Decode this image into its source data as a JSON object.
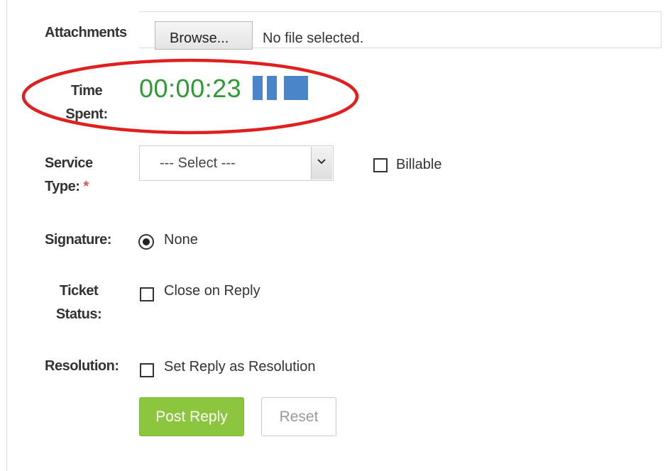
{
  "form": {
    "attachments": {
      "label": "Attachments",
      "browse_label": "Browse...",
      "status": "No file selected."
    },
    "time_spent": {
      "label_line1": "Time",
      "label_line2": "Spent:",
      "value": "00:00:23",
      "pause_icon": "pause-icon",
      "stop_icon": "stop-icon",
      "timer_color": "#2f9a35",
      "control_color": "#4a85c9"
    },
    "service_type": {
      "label_line1": "Service",
      "label_line2": "Type:",
      "required_mark": "*",
      "selected": "--- Select ---"
    },
    "billable": {
      "label": "Billable",
      "checked": false
    },
    "signature": {
      "label": "Signature:",
      "option": "None",
      "selected": true
    },
    "ticket_status": {
      "label_line1": "Ticket",
      "label_line2": "Status:",
      "option": "Close on Reply",
      "checked": false
    },
    "resolution": {
      "label": "Resolution:",
      "option": "Set Reply as Resolution",
      "checked": false
    },
    "actions": {
      "post_label": "Post Reply",
      "reset_label": "Reset",
      "post_color": "#8cc63e"
    }
  },
  "annotation": {
    "highlight_color": "#e0201e"
  }
}
